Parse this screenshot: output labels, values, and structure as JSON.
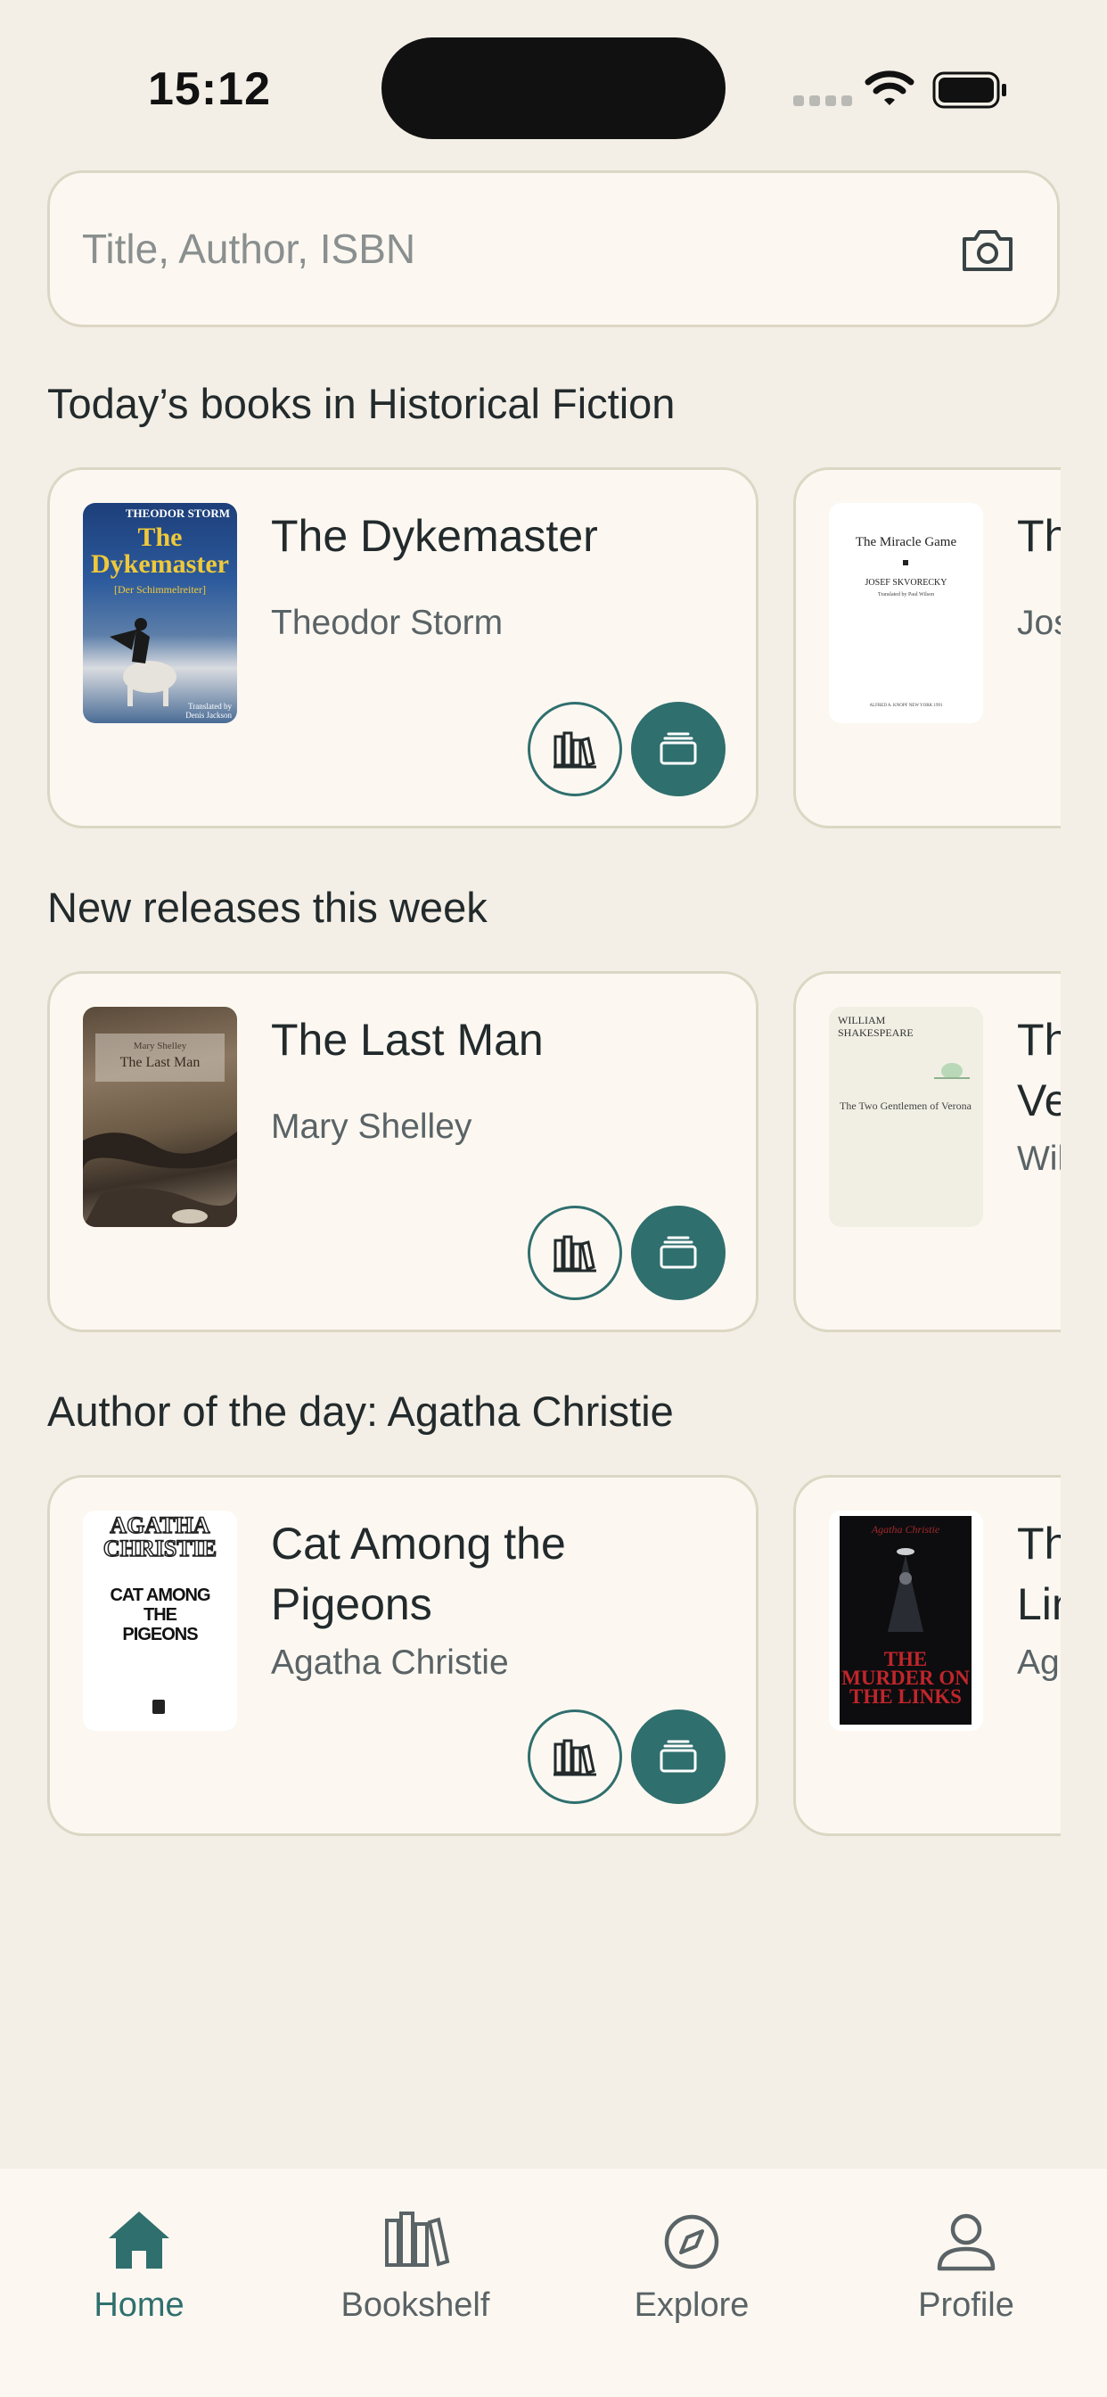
{
  "status_bar": {
    "time": "15:12"
  },
  "search": {
    "placeholder": "Title, Author, ISBN"
  },
  "sections": [
    {
      "title": "Today’s books in Historical Fiction",
      "books": [
        {
          "title": "The Dykemaster",
          "author": "Theodor Storm",
          "cover": {
            "top": "THEODOR STORM",
            "main": "The Dykemaster",
            "sub": "[Der Schimmelreiter]",
            "foot": "Translated by Denis Jackson"
          }
        },
        {
          "title": "Th",
          "author": "Jos",
          "cover": {
            "top": "The Miracle Game",
            "main": "JOSEF SKVORECKY",
            "sub": "Translated by Paul Wilson",
            "foot": "ALFRED A. KNOPF NEW YORK 1991"
          }
        }
      ]
    },
    {
      "title": "New releases this week",
      "books": [
        {
          "title": "The Last Man",
          "author": "Mary Shelley",
          "cover": {
            "top": "Mary Shelley",
            "main": "The Last Man"
          }
        },
        {
          "title": "Th Ve",
          "author": "Wil",
          "cover": {
            "top": "WILLIAM SHAKESPEARE",
            "main": "The Two Gentlemen of Verona"
          }
        }
      ]
    },
    {
      "title": "Author of the day: Agatha Christie",
      "books": [
        {
          "title": "Cat Among the Pigeons",
          "author": "Agatha Christie",
          "cover": {
            "top": "AGATHA CHRISTIE",
            "main": "CAT AMONG THE PIGEONS"
          }
        },
        {
          "title": "Th Lin",
          "author": "Aga",
          "cover": {
            "top": "Agatha Christie",
            "main": "THE MURDER ON THE LINKS"
          }
        }
      ]
    }
  ],
  "tab_bar": {
    "items": [
      {
        "label": "Home",
        "icon": "home-icon",
        "active": true
      },
      {
        "label": "Bookshelf",
        "icon": "bookshelf-icon"
      },
      {
        "label": "Explore",
        "icon": "compass-icon"
      },
      {
        "label": "Profile",
        "icon": "person-icon"
      }
    ]
  },
  "colors": {
    "accent": "#2f6f6e",
    "background": "#f3efe6",
    "card": "#fcf8f1",
    "border": "#dcd6c4"
  }
}
